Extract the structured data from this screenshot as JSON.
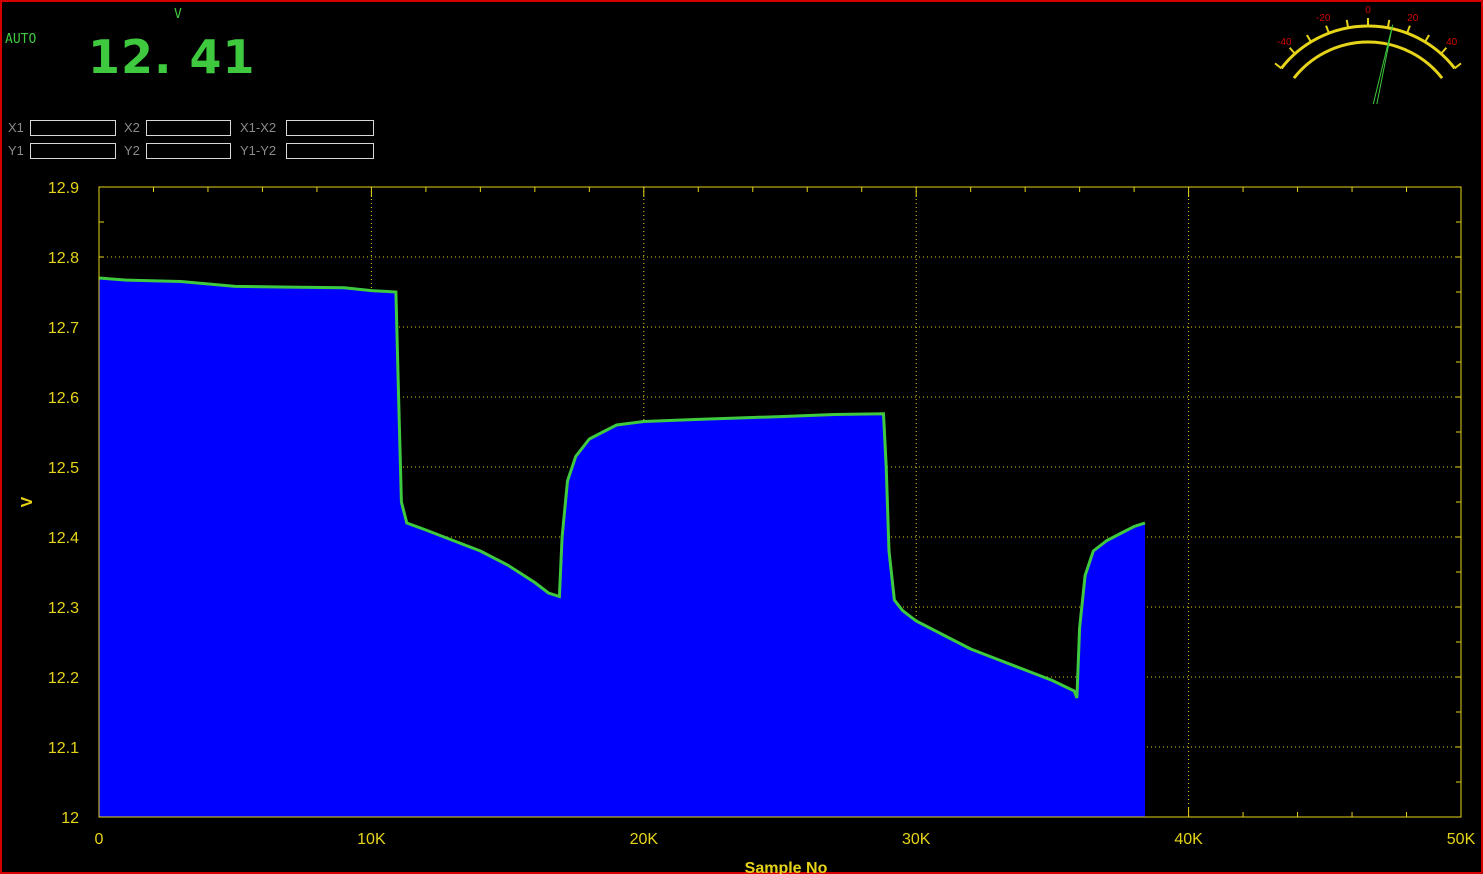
{
  "readout": {
    "mode": "AUTO",
    "unit": "V",
    "value": "12. 41"
  },
  "cursors": {
    "x1_label": "X1",
    "x2_label": "X2",
    "x_diff_label": "X1-X2",
    "y1_label": "Y1",
    "y2_label": "Y2",
    "y_diff_label": "Y1-Y2",
    "x1_value": "",
    "x2_value": "",
    "x_diff_value": "",
    "y1_value": "",
    "y2_value": "",
    "y_diff_value": ""
  },
  "meter": {
    "tick_labels": [
      "-40",
      "-20",
      "0",
      "20",
      "40"
    ],
    "needle_value": 12
  },
  "colors": {
    "background": "#000000",
    "fill": "#0000ff",
    "trace": "#3ec93e",
    "axis_text": "#e6d419",
    "frame": "#d40000",
    "meter_arc": "#e6d419",
    "meter_ticks": "#d40000"
  },
  "chart_data": {
    "type": "area",
    "xlabel": "Sample No",
    "ylabel": "V",
    "xlim": [
      0,
      50000
    ],
    "ylim": [
      12.0,
      12.9
    ],
    "x_ticks": [
      0,
      10000,
      20000,
      30000,
      40000,
      50000
    ],
    "x_tick_labels": [
      "0",
      "10K",
      "20K",
      "30K",
      "40K",
      "50K"
    ],
    "y_ticks": [
      12.0,
      12.1,
      12.2,
      12.3,
      12.4,
      12.5,
      12.6,
      12.7,
      12.8,
      12.9
    ],
    "y_tick_labels": [
      "12",
      "12.1",
      "12.2",
      "12.3",
      "12.4",
      "12.5",
      "12.6",
      "12.7",
      "12.8",
      "12.9"
    ],
    "grid": true,
    "series": [
      {
        "x": [
          0,
          1000,
          3000,
          5000,
          7000,
          9000,
          10000,
          10900,
          11000,
          11100,
          11300,
          12000,
          13000,
          14000,
          15000,
          16000,
          16500,
          16900,
          17000,
          17200,
          17500,
          18000,
          18500,
          19000,
          20000,
          22000,
          25000,
          27000,
          28800,
          28900,
          29000,
          29200,
          29500,
          30000,
          31000,
          32000,
          33000,
          34000,
          35000,
          35800,
          35900,
          36000,
          36200,
          36500,
          37000,
          37500,
          38000,
          38400
        ],
        "y": [
          12.77,
          12.767,
          12.765,
          12.758,
          12.757,
          12.756,
          12.752,
          12.75,
          12.6,
          12.45,
          12.42,
          12.41,
          12.395,
          12.38,
          12.36,
          12.335,
          12.32,
          12.315,
          12.4,
          12.48,
          12.515,
          12.54,
          12.55,
          12.56,
          12.565,
          12.568,
          12.572,
          12.575,
          12.576,
          12.5,
          12.38,
          12.31,
          12.295,
          12.28,
          12.26,
          12.24,
          12.225,
          12.21,
          12.195,
          12.18,
          12.17,
          12.27,
          12.345,
          12.38,
          12.395,
          12.405,
          12.415,
          12.42
        ]
      }
    ]
  }
}
